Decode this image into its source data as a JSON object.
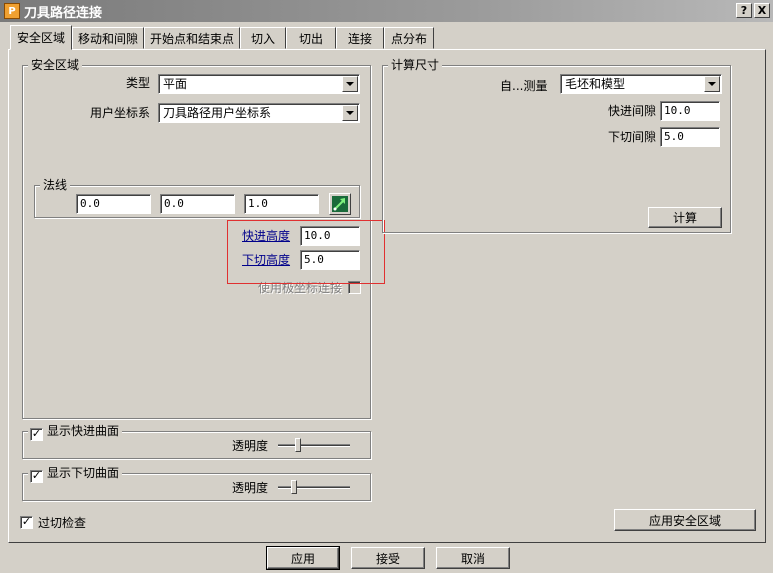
{
  "window": {
    "title": "刀具路径连接",
    "icon_letter": "P",
    "help_label": "?",
    "close_label": "X"
  },
  "tabs": [
    {
      "label": "安全区域"
    },
    {
      "label": "移动和间隙"
    },
    {
      "label": "开始点和结束点"
    },
    {
      "label": "切入"
    },
    {
      "label": "切出"
    },
    {
      "label": "连接"
    },
    {
      "label": "点分布"
    }
  ],
  "safe_area": {
    "group_label": "安全区域",
    "type_label": "类型",
    "type_value": "平面",
    "ucs_label": "用户坐标系",
    "ucs_value": "刀具路径用户坐标系",
    "normal_group_label": "法线",
    "normal_x": "0.0",
    "normal_y": "0.0",
    "normal_z": "1.0",
    "normal_icon": "pick-direction-icon",
    "rapid_height_label": "快进高度",
    "rapid_height_value": "10.0",
    "plunge_height_label": "下切高度",
    "plunge_height_value": "5.0",
    "polar_connect_label": "使用极坐标连接",
    "polar_connect_checked": false
  },
  "calc_size": {
    "group_label": "计算尺寸",
    "measure_label": "自...测量",
    "measure_value": "毛坯和模型",
    "rapid_gap_label": "快进间隙",
    "rapid_gap_value": "10.0",
    "plunge_gap_label": "下切间隙",
    "plunge_gap_value": "5.0",
    "calculate_label": "计算"
  },
  "show_rapid_surface": {
    "label": "显示快进曲面",
    "checked": true,
    "transparency_label": "透明度",
    "transparency_level": 0.25
  },
  "show_plunge_surface": {
    "label": "显示下切曲面",
    "checked": true,
    "transparency_label": "透明度",
    "transparency_level": 0.2
  },
  "gouge_check": {
    "label": "过切检查",
    "checked": true
  },
  "apply_safe_area_label": "应用安全区域",
  "footer": {
    "apply": "应用",
    "accept": "接受",
    "cancel": "取消"
  },
  "colors": {
    "highlight": "#e03030",
    "link": "#00008b",
    "face": "#d4d0c8"
  }
}
